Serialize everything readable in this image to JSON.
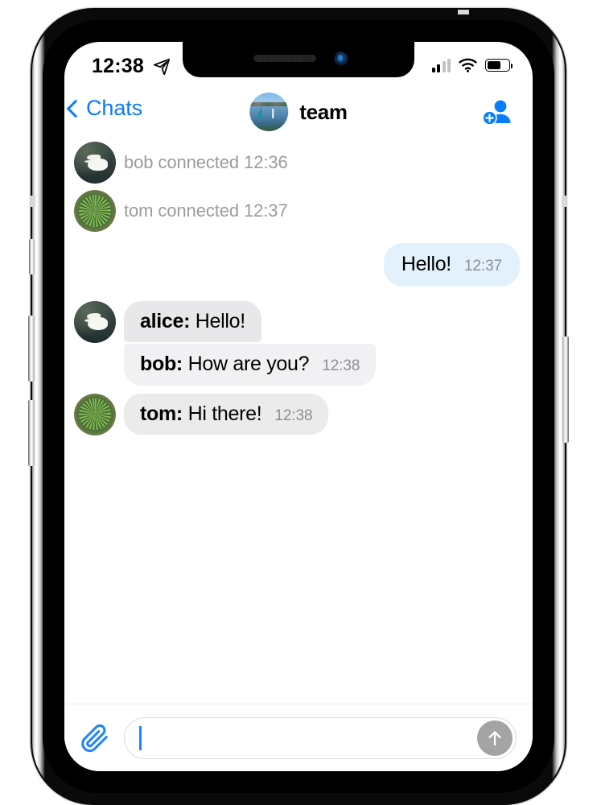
{
  "status_bar": {
    "time": "12:38",
    "location_icon": "location-arrow-icon",
    "signal_icon": "cellular-signal-icon",
    "signal_bars_filled": 2,
    "signal_bars_total": 4,
    "wifi_icon": "wifi-icon",
    "battery_icon": "battery-icon",
    "battery_level_percent": 60
  },
  "nav_bar": {
    "back_label": "Chats",
    "back_icon": "chevron-left-icon",
    "title": "team",
    "avatar_icon": "group-avatar-river-sailboats",
    "action_icon": "add-person-icon",
    "accent_color": "#0a7cff"
  },
  "messages": [
    {
      "kind": "system",
      "avatar": "swan-avatar",
      "text": "bob connected 12:36"
    },
    {
      "kind": "system",
      "avatar": "plant-avatar",
      "text": "tom connected 12:37"
    },
    {
      "kind": "outgoing",
      "text": "Hello!",
      "time": "12:37"
    },
    {
      "kind": "incoming-group",
      "avatar": "swan-avatar",
      "lines": [
        {
          "sender": "alice:",
          "text": " Hello!",
          "time": ""
        },
        {
          "sender": "bob:",
          "text": " How are you?",
          "time": "12:38"
        }
      ]
    },
    {
      "kind": "incoming",
      "avatar": "plant-avatar",
      "sender": "tom:",
      "text": " Hi there!",
      "time": "12:38"
    }
  ],
  "composer": {
    "attach_icon": "paperclip-icon",
    "input_value": "",
    "input_placeholder": "",
    "send_icon": "arrow-up-icon",
    "send_enabled": false
  },
  "colors": {
    "ios_blue": "#0a7cff",
    "outgoing_bubble": "#e2f1fb",
    "incoming_bubble": "#ebebec",
    "system_text": "#9b9b9b",
    "timestamp": "#8e8e93",
    "send_button_disabled": "#a4a4a4"
  }
}
